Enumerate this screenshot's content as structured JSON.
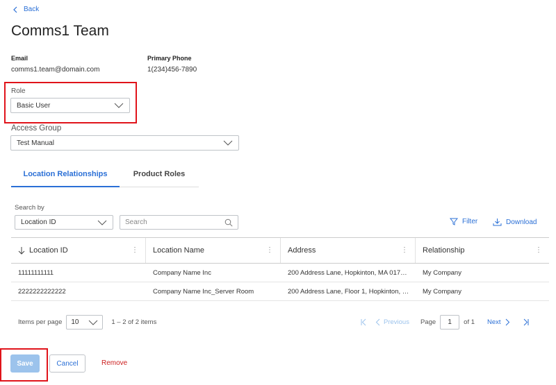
{
  "nav": {
    "back_label": "Back"
  },
  "page": {
    "title": "Comms1 Team"
  },
  "contact": {
    "email_label": "Email",
    "email_value": "comms1.team@domain.com",
    "phone_label": "Primary Phone",
    "phone_value": "1(234)456-7890"
  },
  "role": {
    "label": "Role",
    "value": "Basic User"
  },
  "access_group": {
    "label": "Access Group",
    "value": "Test Manual"
  },
  "tabs": [
    {
      "label": "Location Relationships",
      "active": true
    },
    {
      "label": "Product Roles",
      "active": false
    }
  ],
  "toolbar": {
    "search_by_label": "Search by",
    "search_by_value": "Location ID",
    "search_placeholder": "Search",
    "filter_label": "Filter",
    "download_label": "Download"
  },
  "table": {
    "columns": [
      "Location ID",
      "Location Name",
      "Address",
      "Relationship"
    ],
    "rows": [
      [
        "11111111111",
        "Company Name Inc",
        "200 Address Lane, Hopkinton, MA 017…",
        "My Company"
      ],
      [
        "2222222222222",
        "Company Name Inc_Server Room",
        "200 Address Lane, Floor 1, Hopkinton, …",
        "My Company"
      ]
    ]
  },
  "pager": {
    "items_per_page_label": "Items per page",
    "items_per_page_value": "10",
    "range_text": "1 – 2 of 2 items",
    "previous_label": "Previous",
    "page_label": "Page",
    "page_value": "1",
    "of_text": "of 1",
    "next_label": "Next"
  },
  "actions": {
    "save_label": "Save",
    "cancel_label": "Cancel",
    "remove_label": "Remove"
  },
  "colors": {
    "accent": "#2a6fd6",
    "highlight": "#e0131a",
    "remove": "#cc1f1f",
    "save_disabled": "#9cc3ec"
  }
}
